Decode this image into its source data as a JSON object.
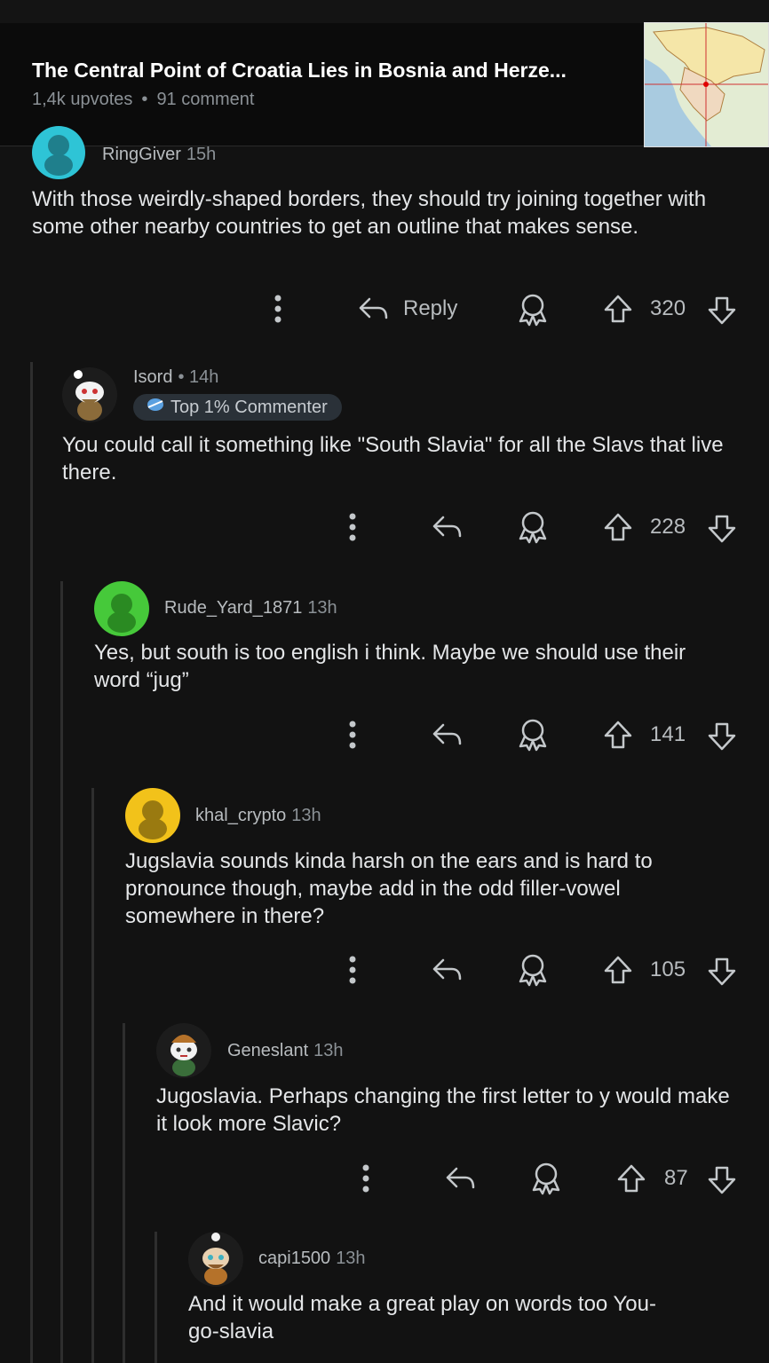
{
  "post": {
    "title": "The Central Point of Croatia Lies in Bosnia and Herze...",
    "upvotes": "1,4k upvotes",
    "comments": "91 comment"
  },
  "comments": [
    {
      "user": "RingGiver",
      "time": "15h",
      "text": "With those weirdly-shaped borders, they should try joining together with some other nearby countries to get an outline that makes sense.",
      "reply": "Reply",
      "score": "320",
      "avatar_color": "#2ec4d6"
    },
    {
      "user": "Isord",
      "time": "• 14h",
      "badge": "Top 1% Commenter",
      "text": "You could call it something like \"South Slavia\" for all the Slavs that live there.",
      "score": "228"
    },
    {
      "user": "Rude_Yard_1871",
      "time": "13h",
      "text": "Yes, but south is too english i think. Maybe we should use their word “jug”",
      "score": "141",
      "avatar_color": "#46c93a"
    },
    {
      "user": "khal_crypto",
      "time": "13h",
      "text": "Jugslavia sounds kinda harsh on the ears and is hard to pronounce though, maybe add in the odd filler-vowel somewhere in there?",
      "score": "105",
      "avatar_color": "#f2c21a"
    },
    {
      "user": "Geneslant",
      "time": "13h",
      "text": "Jugoslavia. Perhaps changing the first letter to y would make it look more Slavic?",
      "score": "87"
    },
    {
      "user": "capi1500",
      "time": "13h",
      "text": "And it would make a great play on words too You-go-slavia"
    }
  ],
  "icons": {
    "more": "more-vertical-icon",
    "reply": "reply-arrow-icon",
    "award": "award-icon",
    "upvote": "upvote-arrow-icon",
    "downvote": "downvote-arrow-icon"
  },
  "colors": {
    "background": "#121212",
    "header": "#0b0b0b",
    "text": "#e4e6e8",
    "muted": "#8b9196"
  }
}
